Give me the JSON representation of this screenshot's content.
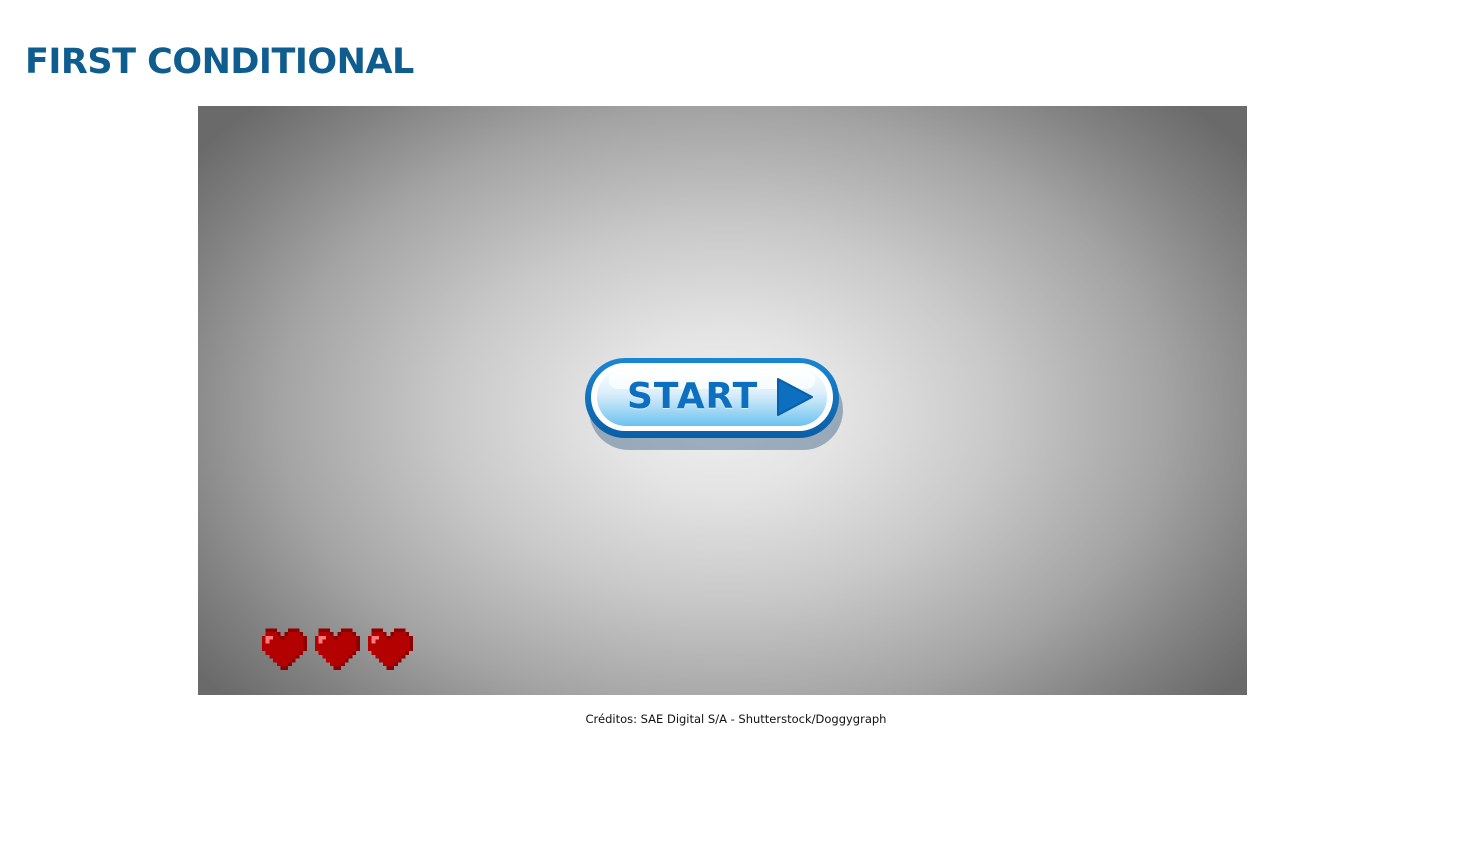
{
  "page": {
    "title": "FIRST CONDITIONAL",
    "title_color": "#0e5d8e"
  },
  "game": {
    "start_button": {
      "label": "START",
      "icon": "play-icon",
      "accent_color": "#0c6fbf"
    },
    "lives": {
      "count": 3,
      "icon": "heart-icon",
      "color": "#b00000"
    }
  },
  "footer": {
    "credits": "Créditos: SAE Digital S/A - Shutterstock/Doggygraph"
  }
}
